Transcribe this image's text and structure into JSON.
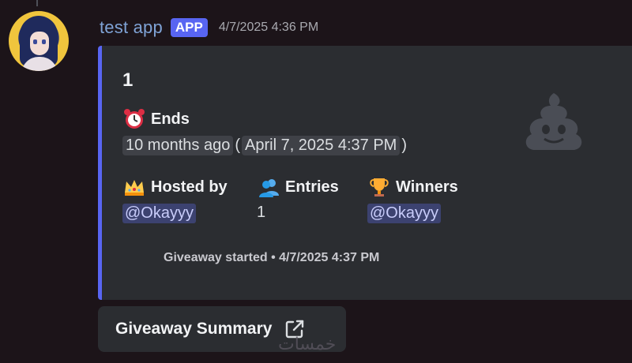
{
  "message": {
    "username": "test app",
    "badge": "APP",
    "timestamp": "4/7/2025 4:36 PM",
    "avatar_icon": "anime-avatar"
  },
  "embed": {
    "accent_color": "#5865f2",
    "title": "1",
    "thumbnail_icon": "poop-emoji-icon",
    "ends": {
      "icon": "alarm-clock-icon",
      "label": "Ends",
      "relative": "10 months ago",
      "absolute": "April 7, 2025 4:37 PM",
      "paren_open": "(",
      "paren_close": ")"
    },
    "hosted_by": {
      "icon": "crown-icon",
      "label": "Hosted by",
      "value": "@Okayyy"
    },
    "entries": {
      "icon": "busts-icon",
      "label": "Entries",
      "value": "1"
    },
    "winners": {
      "icon": "trophy-icon",
      "label": "Winners",
      "value": "@Okayyy"
    },
    "footer": "Giveaway started • 4/7/2025 4:37 PM"
  },
  "button": {
    "label": "Giveaway Summary",
    "icon": "external-link-icon"
  },
  "watermark": "خمسات"
}
